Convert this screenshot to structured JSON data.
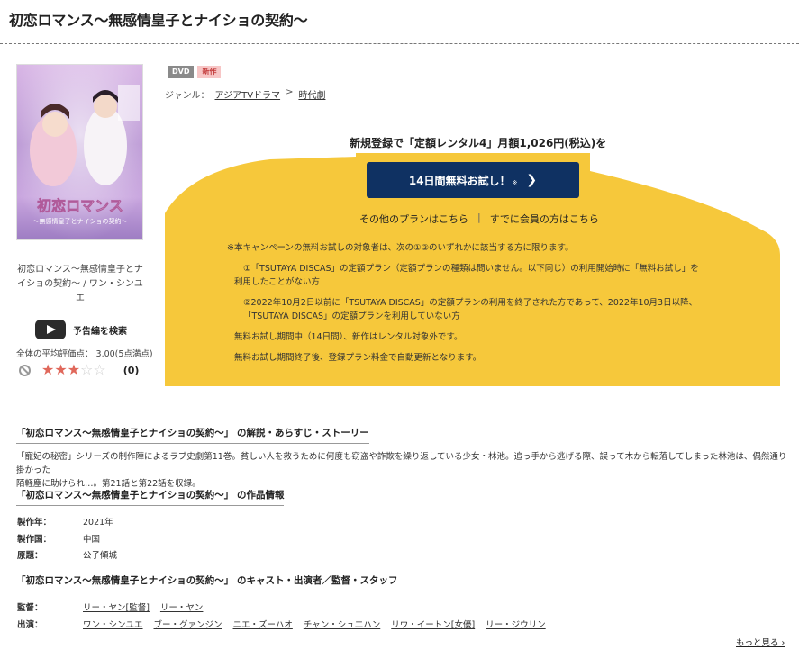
{
  "page": {
    "title": "初恋ロマンス〜無感情皇子とナイショの契約〜"
  },
  "product": {
    "cover_caption": "初恋ロマンス〜無感情皇子とナイショの契約〜 / ワン・シンユエ",
    "cover_art_lines": [
      "初恋ロマンス",
      "〜無感情皇子とナイショの契約〜"
    ],
    "trailer_label": "予告編を検索",
    "rating_text": "全体の平均評価点： 3.00(5点満点)",
    "rating_value": 3,
    "rating_max": 5,
    "review_count": "(0)",
    "badges": [
      "DVD",
      "新作"
    ],
    "genre_label": "ジャンル：",
    "genre": [
      "アジアTVドラマ",
      "時代劇"
    ],
    "genre_sep": ">"
  },
  "campaign": {
    "headline": "新規登録で「定額レンタル4」月額1,026円(税込)を",
    "trial_button": "14日間無料お試し！",
    "trial_sup": "※",
    "trial_chevron": "❯",
    "other_plans": "その他のプランはこちら",
    "separator": "|",
    "member_link": "すでに会員の方はこちら",
    "notes": [
      "※本キャンペーンの無料お試しの対象者は、次の①②のいずれかに該当する方に限ります。",
      "①「TSUTAYA DISCAS」の定額プラン（定額プランの種類は問いません。以下同じ）の利用開始時に「無料お試し」を",
      "利用したことがない方",
      "②2022年10月2日以前に「TSUTAYA DISCAS」の定額プランの利用を終了された方であって、2022年10月3日以降、",
      "「TSUTAYA DISCAS」の定額プランを利用していない方",
      "無料お試し期間中（14日間）、新作はレンタル対象外です。",
      "無料お試し期間終了後、登録プラン料金で自動更新となります。"
    ],
    "colors": {
      "yellow": "#f6c83b",
      "navy": "#0f3162"
    }
  },
  "synopsis": {
    "heading": "「初恋ロマンス〜無感情皇子とナイショの契約〜」 の解説・あらすじ・ストーリー",
    "lines": [
      "「寵妃の秘密」シリーズの制作陣によるラブ史劇第11巻。貧しい人を救うために何度も窃盗や詐欺を繰り返している少女・林池。追っ手から逃げる際、誤って木から転落してしまった林池は、偶然通り掛かった",
      "陌軽塵に助けられ…。第21話と第22話を収録。"
    ]
  },
  "info": {
    "heading": "「初恋ロマンス〜無感情皇子とナイショの契約〜」 の作品情報",
    "rows": [
      {
        "key": "製作年：",
        "value": "2021年"
      },
      {
        "key": "製作国：",
        "value": "中国"
      },
      {
        "key": "原題：",
        "value": "公子傾城"
      }
    ]
  },
  "cast": {
    "heading": "「初恋ロマンス〜無感情皇子とナイショの契約〜」 のキャスト・出演者／監督・スタッフ",
    "director_label": "監督：",
    "directors": [
      "リー・ヤン[監督]",
      "リー・ヤン"
    ],
    "cast_label": "出演：",
    "actors": [
      "ワン・シンユエ",
      "ブー・グァンジン",
      "ニエ・ズーハオ",
      "チャン・シュエハン",
      "リウ・イートン[女優]",
      "リー・ジウリン"
    ],
    "more": "もっと見る ›"
  }
}
